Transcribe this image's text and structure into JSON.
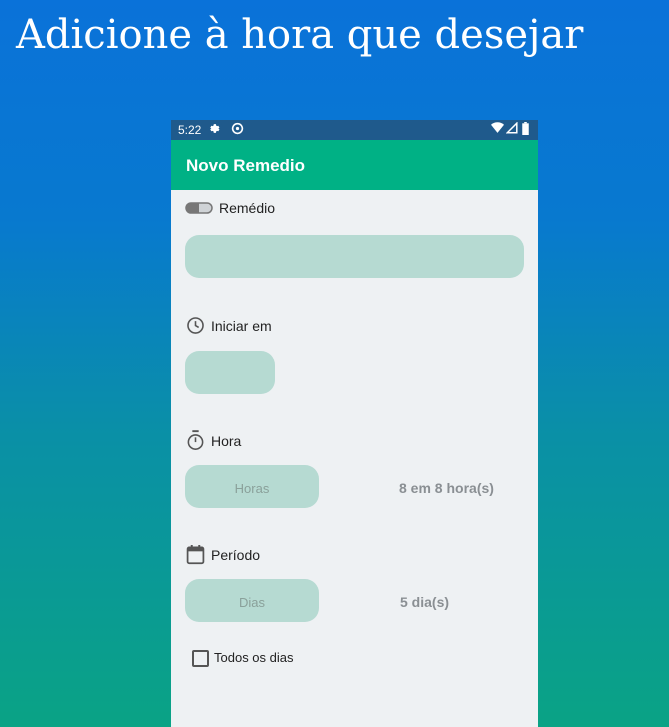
{
  "headline": "Adicione à hora que desejar",
  "statusbar": {
    "time": "5:22",
    "icons": [
      "settings-icon",
      "location-icon",
      "wifi-icon",
      "signal-icon",
      "battery-icon"
    ]
  },
  "appbar": {
    "title": "Novo Remedio"
  },
  "form": {
    "remedio": {
      "label": "Remédio",
      "value": ""
    },
    "iniciar": {
      "label": "Iniciar em",
      "value": ""
    },
    "hora": {
      "label": "Hora",
      "placeholder": "Horas",
      "summary": "8 em 8 hora(s)"
    },
    "periodo": {
      "label": "Período",
      "placeholder": "Dias",
      "summary": "5 dia(s)"
    },
    "todos_dias": {
      "label": "Todos os dias",
      "checked": false
    }
  },
  "colors": {
    "appbar": "#00b185",
    "field": "#b6dad2",
    "statusbar": "#1f5a8c",
    "screen_bg": "#eef1f3"
  }
}
